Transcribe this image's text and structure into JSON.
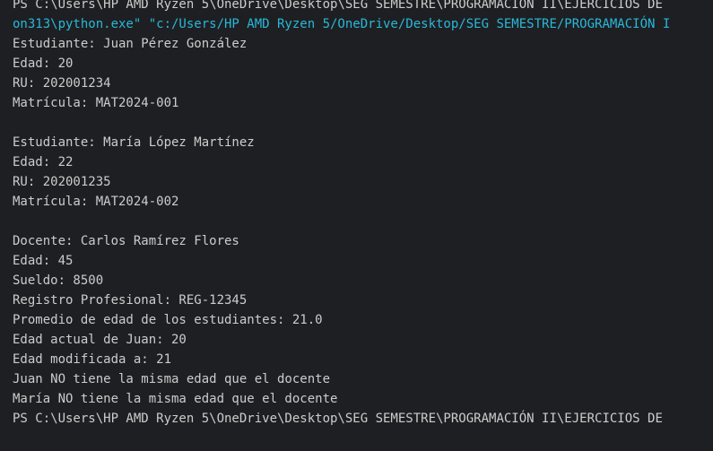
{
  "terminal": {
    "lines": [
      {
        "kind": "prompt",
        "text": "PS C:\\Users\\HP AMD Ryzen 5\\OneDrive\\Desktop\\SEG SEMESTRE\\PROGRAMACION II\\EJERCICIOS DE"
      },
      {
        "kind": "command",
        "text": "on313\\python.exe\" \"c:/Users/HP AMD Ryzen 5/OneDrive/Desktop/SEG SEMESTRE/PROGRAMACIÓN I"
      },
      {
        "kind": "output",
        "text": "Estudiante: Juan Pérez González"
      },
      {
        "kind": "output",
        "text": "Edad: 20"
      },
      {
        "kind": "output",
        "text": "RU: 202001234"
      },
      {
        "kind": "output",
        "text": "Matrícula: MAT2024-001"
      },
      {
        "kind": "blank",
        "text": ""
      },
      {
        "kind": "output",
        "text": "Estudiante: María López Martínez"
      },
      {
        "kind": "output",
        "text": "Edad: 22"
      },
      {
        "kind": "output",
        "text": "RU: 202001235"
      },
      {
        "kind": "output",
        "text": "Matrícula: MAT2024-002"
      },
      {
        "kind": "blank",
        "text": ""
      },
      {
        "kind": "output",
        "text": "Docente: Carlos Ramírez Flores"
      },
      {
        "kind": "output",
        "text": "Edad: 45"
      },
      {
        "kind": "output",
        "text": "Sueldo: 8500"
      },
      {
        "kind": "output",
        "text": "Registro Profesional: REG-12345"
      },
      {
        "kind": "output",
        "text": "Promedio de edad de los estudiantes: 21.0"
      },
      {
        "kind": "output",
        "text": "Edad actual de Juan: 20"
      },
      {
        "kind": "output",
        "text": "Edad modificada a: 21"
      },
      {
        "kind": "output",
        "text": "Juan NO tiene la misma edad que el docente"
      },
      {
        "kind": "output",
        "text": "María NO tiene la misma edad que el docente"
      },
      {
        "kind": "prompt",
        "text": "PS C:\\Users\\HP AMD Ryzen 5\\OneDrive\\Desktop\\SEG SEMESTRE\\PROGRAMACIÓN II\\EJERCICIOS DE"
      }
    ]
  }
}
